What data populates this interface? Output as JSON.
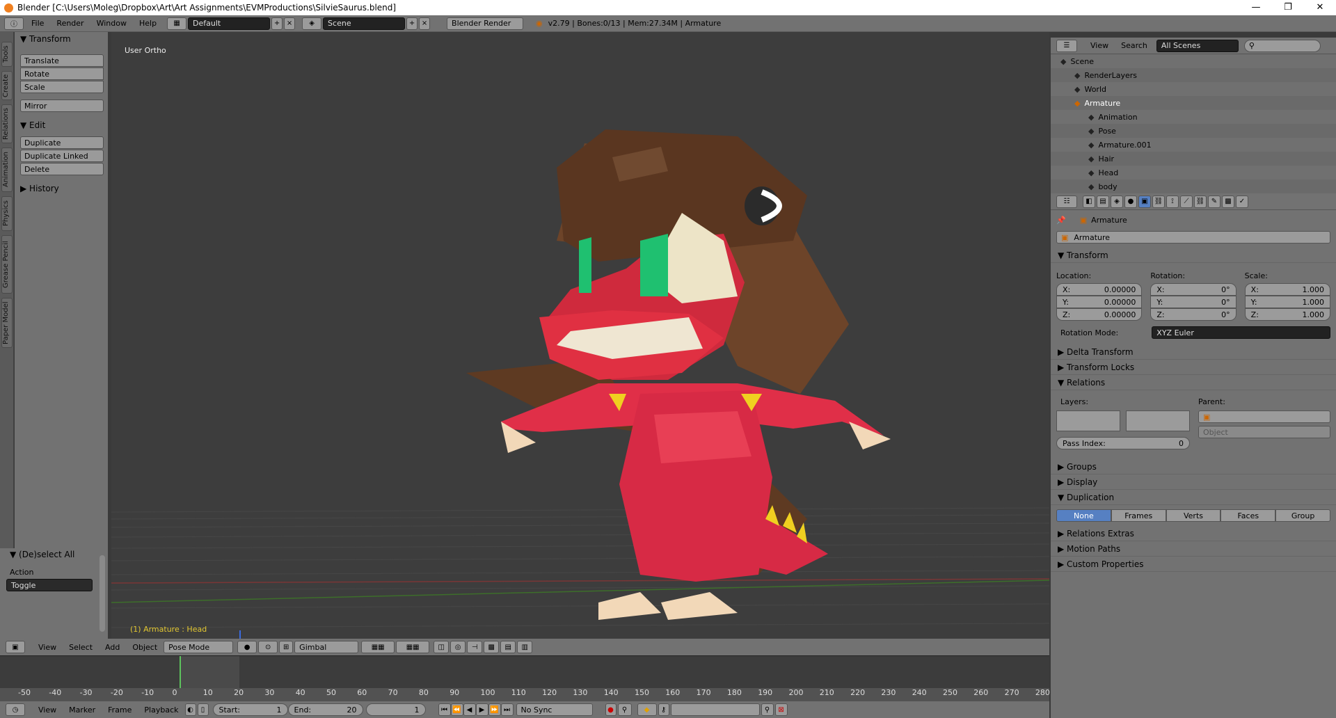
{
  "window": {
    "title": "Blender [C:\\Users\\Moleg\\Dropbox\\Art\\Art Assignments\\EVMProductions\\SilvieSaurus.blend]",
    "controls": [
      "—",
      "❐",
      "✕"
    ]
  },
  "topbar": {
    "menus": [
      "File",
      "Render",
      "Window",
      "Help"
    ],
    "layout": "Default",
    "scene": "Scene",
    "engine": "Blender Render",
    "status": "v2.79 | Bones:0/13 | Mem:27.34M | Armature"
  },
  "lefttabs": [
    "Tools",
    "Create",
    "Relations",
    "Animation",
    "Physics",
    "Grease Pencil",
    "Paper Model"
  ],
  "toolshelf": {
    "transform_title": "Transform",
    "transform_buttons": [
      "Translate",
      "Rotate",
      "Scale"
    ],
    "mirror": "Mirror",
    "edit_title": "Edit",
    "edit_buttons": [
      "Duplicate",
      "Duplicate Linked",
      "Delete"
    ],
    "history": "History",
    "deselect": "(De)select All",
    "action_label": "Action",
    "action_value": "Toggle"
  },
  "viewport": {
    "view_label": "User Ortho",
    "object_label": "(1) Armature : Head"
  },
  "vpbar": {
    "menus": [
      "View",
      "Select",
      "Add",
      "Object"
    ],
    "mode": "Pose Mode",
    "orientation": "Gimbal"
  },
  "timeline": {
    "ticks": [
      "-50",
      "-40",
      "-30",
      "-20",
      "-10",
      "0",
      "10",
      "20",
      "30",
      "40",
      "50",
      "60",
      "70",
      "80",
      "90",
      "100",
      "110",
      "120",
      "130",
      "140",
      "150",
      "160",
      "170",
      "180",
      "190",
      "200",
      "210",
      "220",
      "230",
      "240",
      "250",
      "260",
      "270",
      "280"
    ]
  },
  "tlbar": {
    "menus": [
      "View",
      "Marker",
      "Frame",
      "Playback"
    ],
    "start_label": "Start:",
    "start": "1",
    "end_label": "End:",
    "end": "20",
    "current": "1",
    "sync": "No Sync"
  },
  "outliner": {
    "menus": [
      "View",
      "Search"
    ],
    "filter": "All Scenes",
    "items": [
      {
        "label": "Scene",
        "indent": 0
      },
      {
        "label": "RenderLayers",
        "indent": 1
      },
      {
        "label": "World",
        "indent": 1
      },
      {
        "label": "Armature",
        "indent": 1,
        "selected": true
      },
      {
        "label": "Animation",
        "indent": 2
      },
      {
        "label": "Pose",
        "indent": 2
      },
      {
        "label": "Armature.001",
        "indent": 2
      },
      {
        "label": "Hair",
        "indent": 2
      },
      {
        "label": "Head",
        "indent": 2
      },
      {
        "label": "body",
        "indent": 2
      }
    ]
  },
  "props": {
    "breadcrumb": "Armature",
    "name": "Armature",
    "transform": "Transform",
    "location_label": "Location:",
    "rotation_label": "Rotation:",
    "scale_label": "Scale:",
    "loc": [
      {
        "axis": "X:",
        "val": "0.00000"
      },
      {
        "axis": "Y:",
        "val": "0.00000"
      },
      {
        "axis": "Z:",
        "val": "0.00000"
      }
    ],
    "rot": [
      {
        "axis": "X:",
        "val": "0°"
      },
      {
        "axis": "Y:",
        "val": "0°"
      },
      {
        "axis": "Z:",
        "val": "0°"
      }
    ],
    "scl": [
      {
        "axis": "X:",
        "val": "1.000"
      },
      {
        "axis": "Y:",
        "val": "1.000"
      },
      {
        "axis": "Z:",
        "val": "1.000"
      }
    ],
    "rotmode_label": "Rotation Mode:",
    "rotmode": "XYZ Euler",
    "delta": "Delta Transform",
    "locks": "Transform Locks",
    "relations": "Relations",
    "layers_label": "Layers:",
    "parent_label": "Parent:",
    "parent_type": "Object",
    "pass_label": "Pass Index:",
    "pass_val": "0",
    "groups": "Groups",
    "display": "Display",
    "duplication": "Duplication",
    "dup_opts": [
      "None",
      "Frames",
      "Verts",
      "Faces",
      "Group"
    ],
    "rel_extras": "Relations Extras",
    "motion": "Motion Paths",
    "custom": "Custom Properties"
  }
}
